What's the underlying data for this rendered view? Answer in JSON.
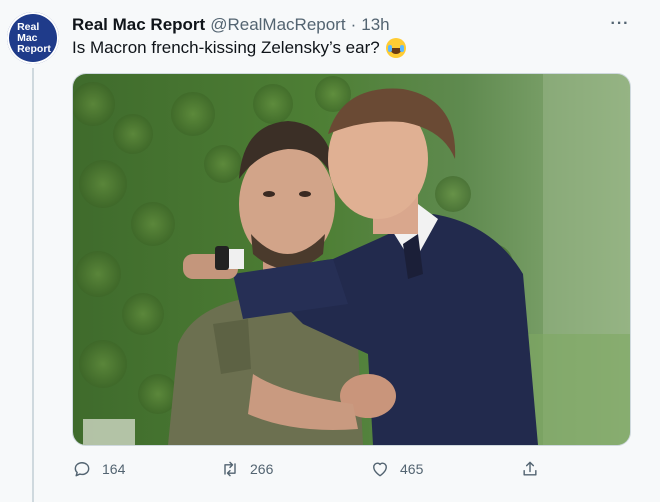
{
  "tweet": {
    "author_name": "Real Mac Report",
    "handle": "@RealMacReport",
    "separator": "·",
    "time": "13h",
    "text": "Is Macron french-kissing Zelensky’s ear?",
    "emoji": "face-with-tears-of-joy",
    "avatar_text": "Real\nMac\nReport",
    "more_label": "···"
  },
  "actions": {
    "reply_count": "164",
    "retweet_count": "266",
    "like_count": "465"
  },
  "colors": {
    "background": "#f7f9fa",
    "text": "#0f1419",
    "muted": "#536471",
    "avatar": "#1f3b8a"
  }
}
